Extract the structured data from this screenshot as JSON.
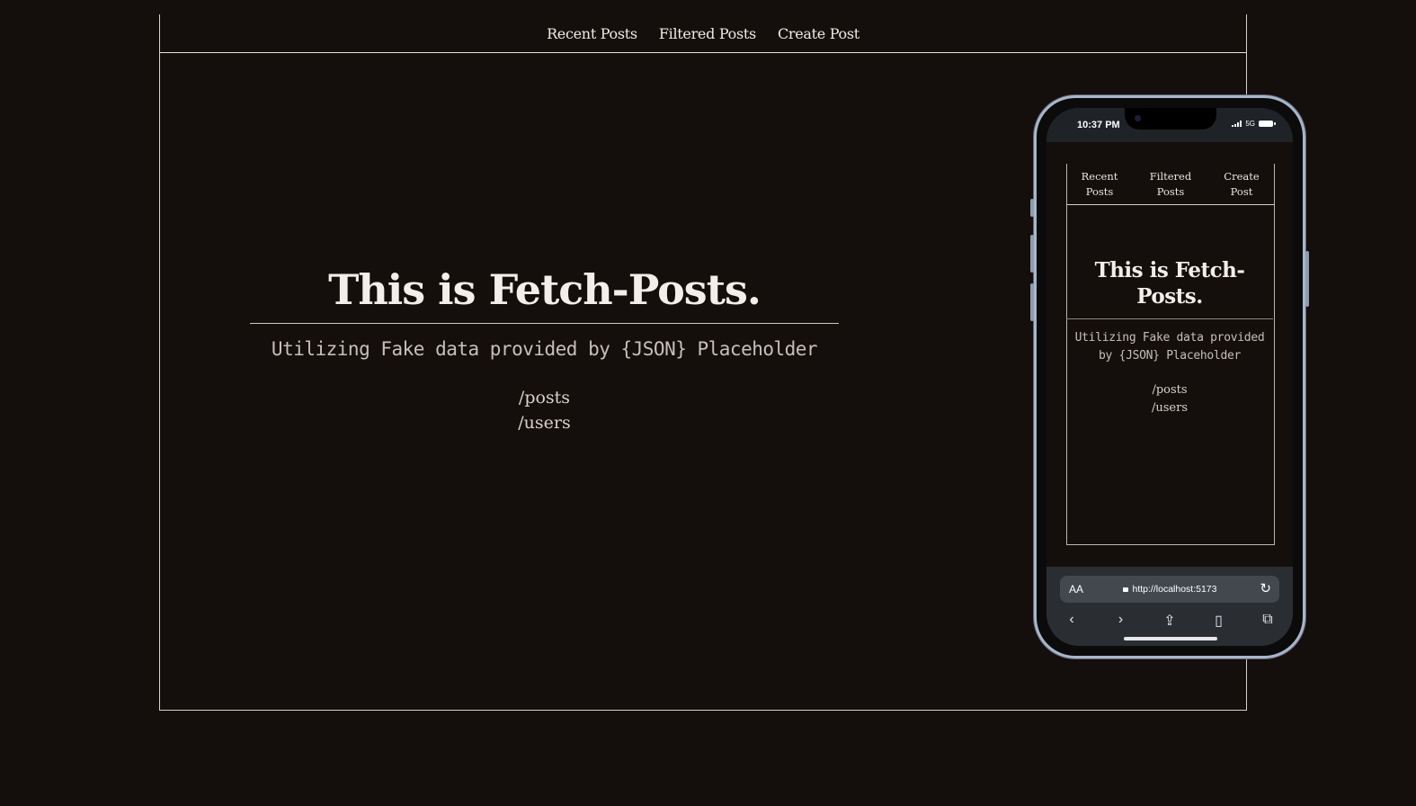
{
  "site": {
    "nav": [
      "Recent Posts",
      "Filtered Posts",
      "Create Post"
    ],
    "hero": {
      "title": "This is Fetch-Posts.",
      "subtitle": "Utilizing Fake data provided by {JSON} Placeholder",
      "endpoints": [
        "/posts",
        "/users"
      ]
    }
  },
  "phone": {
    "status": {
      "time": "10:37 PM",
      "network": "5G"
    },
    "nav": [
      {
        "line1": "Recent",
        "line2": "Posts"
      },
      {
        "line1": "Filtered",
        "line2": "Posts"
      },
      {
        "line1": "Create",
        "line2": "Post"
      }
    ],
    "hero": {
      "title": "This is Fetch-Posts.",
      "subtitle": "Utilizing Fake data provided by {JSON} Placeholder",
      "endpoints": [
        "/posts",
        "/users"
      ]
    },
    "browser": {
      "aa_label": "AA",
      "url": "http://localhost:5173"
    }
  },
  "colors": {
    "background": "#140e0c",
    "text": "#f0ebe6",
    "border": "#d8d2cc"
  }
}
